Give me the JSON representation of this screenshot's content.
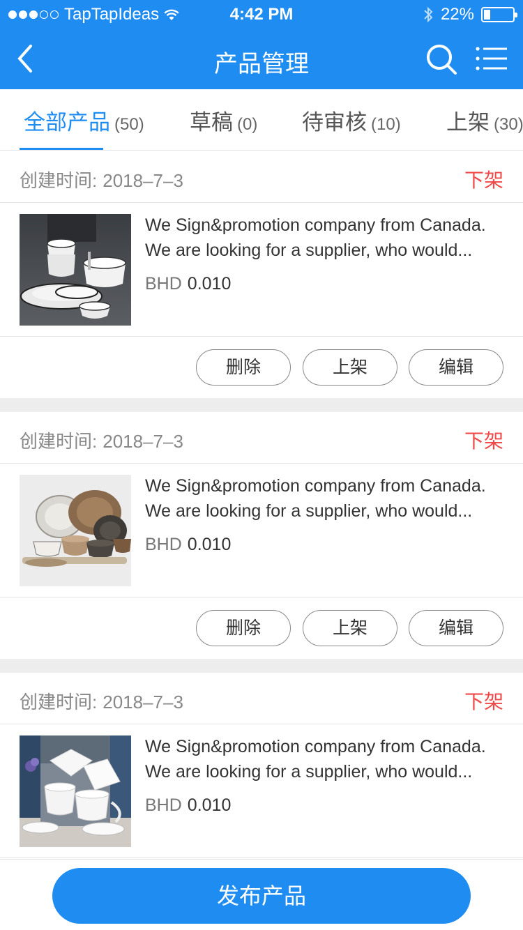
{
  "status_bar": {
    "carrier": "TapTapIdeas",
    "time": "4:42 PM",
    "battery_percent": "22%",
    "battery_level": 0.22,
    "signal_bars_filled": 3,
    "signal_bars_total": 5
  },
  "nav": {
    "title": "产品管理",
    "back_icon": "chevron-left-icon",
    "search_icon": "search-icon",
    "menu_icon": "list-menu-icon"
  },
  "tabs": [
    {
      "label": "全部产品",
      "count": "(50)",
      "active": true
    },
    {
      "label": "草稿",
      "count": "(0)",
      "active": false
    },
    {
      "label": "待审核",
      "count": "(10)",
      "active": false
    },
    {
      "label": "上架",
      "count": "(30)",
      "active": false
    }
  ],
  "products": [
    {
      "created_label": "创建时间:",
      "created_date": "2018–7–3",
      "status_action": "下架",
      "desc_line1": "We Sign&promotion company from Canada.",
      "desc_line2": "We are looking for a supplier, who would...",
      "currency": "BHD",
      "price": "0.010",
      "btn_delete": "删除",
      "btn_list": "上架",
      "btn_edit": "编辑"
    },
    {
      "created_label": "创建时间:",
      "created_date": "2018–7–3",
      "status_action": "下架",
      "desc_line1": "We Sign&promotion company from Canada.",
      "desc_line2": "We are looking for a supplier, who would...",
      "currency": "BHD",
      "price": "0.010",
      "btn_delete": "删除",
      "btn_list": "上架",
      "btn_edit": "编辑"
    },
    {
      "created_label": "创建时间:",
      "created_date": "2018–7–3",
      "status_action": "下架",
      "desc_line1": "We Sign&promotion company from Canada.",
      "desc_line2": "We are looking for a supplier, who would...",
      "currency": "BHD",
      "price": "0.010"
    }
  ],
  "publish_button": "发布产品",
  "colors": {
    "primary": "#1e8cf0",
    "danger": "#f04848",
    "separator": "#ededed"
  }
}
